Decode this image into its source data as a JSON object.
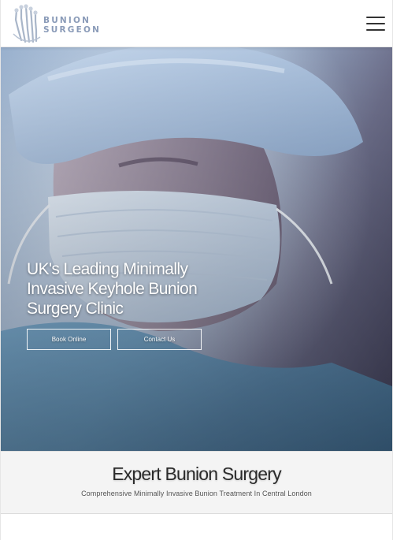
{
  "brand": {
    "line1": "BUNION",
    "line2": "SURGEON",
    "logo_icon": "foot-bones-icon",
    "text_color": "#8a9bb8"
  },
  "header": {
    "menu_icon": "hamburger-menu-icon"
  },
  "hero": {
    "headline": "UK's Leading Minimally Invasive Keyhole Bunion Surgery Clinic",
    "buttons": {
      "book": "Book Online",
      "contact": "Contact Us"
    },
    "image": "surgeon-in-mask-photo"
  },
  "intro": {
    "title": "Expert Bunion Surgery",
    "subtitle": "Comprehensive Minimally Invasive Bunion Treatment In Central London"
  }
}
